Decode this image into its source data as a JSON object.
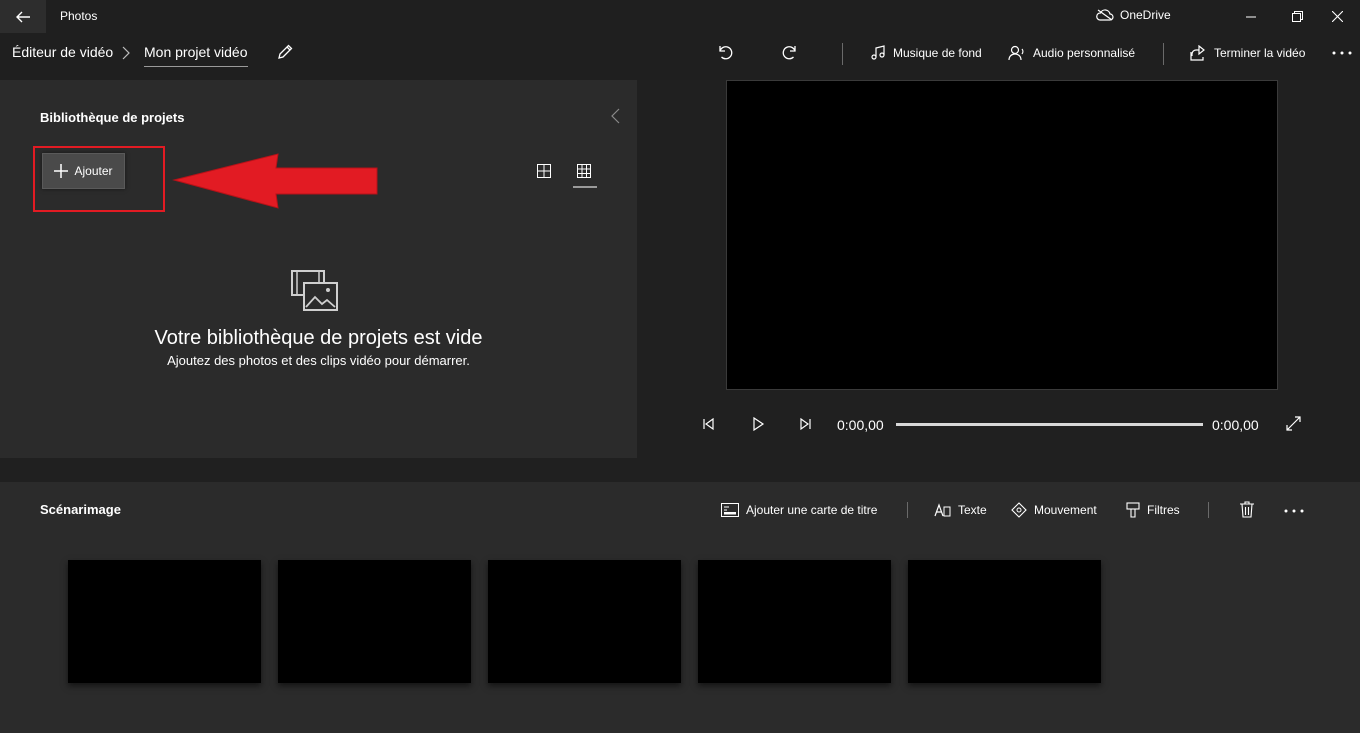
{
  "app": {
    "title": "Photos"
  },
  "titlebar": {
    "cloud_label": "OneDrive"
  },
  "toolbar": {
    "breadcrumb_root": "Éditeur de vidéo",
    "breadcrumb_current": "Mon projet vidéo",
    "music_label": "Musique de fond",
    "custom_audio_label": "Audio personnalisé",
    "finish_label": "Terminer la vidéo"
  },
  "library": {
    "title": "Bibliothèque de projets",
    "add_label": "Ajouter",
    "empty_title": "Votre bibliothèque de projets est vide",
    "empty_subtitle": "Ajoutez des photos et des clips vidéo pour démarrer."
  },
  "player": {
    "current_time": "0:00,00",
    "total_time": "0:00,00",
    "progress": 0
  },
  "storyboard": {
    "title": "Scénarimage",
    "add_title_card_label": "Ajouter une carte de titre",
    "text_label": "Texte",
    "motion_label": "Mouvement",
    "filters_label": "Filtres",
    "slots": [
      "",
      "",
      "",
      "",
      ""
    ]
  },
  "colors": {
    "annotation_red": "#e21b23",
    "background": "#202020",
    "panel": "#2b2b2b"
  },
  "icons": [
    "back-arrow-icon",
    "cloud-off-icon",
    "minimize-icon",
    "maximize-icon",
    "close-icon",
    "pencil-icon",
    "undo-icon",
    "redo-icon",
    "music-note-icon",
    "person-audio-icon",
    "share-icon",
    "more-icon",
    "collapse-chevron-icon",
    "plus-icon",
    "large-grid-icon",
    "small-grid-icon",
    "media-library-icon",
    "step-back-icon",
    "play-icon",
    "step-forward-icon",
    "fullscreen-icon",
    "title-card-icon",
    "text-icon",
    "motion-icon",
    "filter-icon",
    "trash-icon"
  ]
}
